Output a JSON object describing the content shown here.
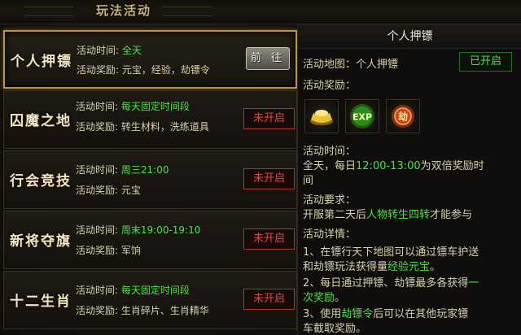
{
  "header": {
    "title": "玩法活动"
  },
  "activities": [
    {
      "name": "个人押镖",
      "time_label": "活动时间:",
      "time": "全天",
      "time_green": true,
      "reward_label": "活动奖励:",
      "reward": "元宝，经验，劫镖令",
      "button": "前 往",
      "status": "open"
    },
    {
      "name": "囚魔之地",
      "time_label": "活动时间:",
      "time": "每天固定时间段",
      "time_green": true,
      "reward_label": "活动奖励:",
      "reward": "转生材料，洗练道具",
      "button": "未开启",
      "status": "closed"
    },
    {
      "name": "行会竞技",
      "time_label": "活动时间:",
      "time": "周三21:00",
      "time_green": true,
      "reward_label": "活动奖励:",
      "reward": "元宝",
      "button": "未开启",
      "status": "closed"
    },
    {
      "name": "新将夺旗",
      "time_label": "活动时间:",
      "time": "周末19:00-19:10",
      "time_green": true,
      "reward_label": "活动奖励:",
      "reward": "军饷",
      "button": "未开启",
      "status": "closed"
    },
    {
      "name": "十二生肖",
      "time_label": "活动时间:",
      "time": "每天固定时间段",
      "time_green": true,
      "reward_label": "活动奖励:",
      "reward": "生肖碎片、生肖精华",
      "button": "未开启",
      "status": "closed"
    }
  ],
  "detail": {
    "title": "个人押镖",
    "map_label": "活动地图：",
    "map": "个人押镖",
    "status": "已开启",
    "reward_label": "活动奖励：",
    "rewards": [
      {
        "icon": "gold-ingot-icon"
      },
      {
        "icon": "exp-icon",
        "text": "EXP"
      },
      {
        "icon": "rob-token-icon",
        "text": "劫"
      }
    ],
    "time_label": "活动时间：",
    "time_prefix": "全天，每日",
    "time_highlight": "12:00-13:00",
    "time_suffix": "为双倍奖励时",
    "time_line2": "间",
    "req_label": "活动要求：",
    "req_prefix": "开服第二天后",
    "req_highlight": "人物转生四转",
    "req_suffix": "才能参与",
    "details_label": "活动详情：",
    "d1_line1": "1、在镖行天下地图可以通过镖车护送",
    "d1_line2_prefix": "和劫镖玩法获得量",
    "d1_line2_highlight": "经验元宝",
    "d1_line2_suffix": "。",
    "d2_line1_prefix": "2、每日通过押镖、劫镖最多各获得",
    "d2_line1_highlight": "一",
    "d2_line2_highlight": "次奖励",
    "d2_line2_suffix": "。",
    "d3_line1_prefix": "3、使用",
    "d3_line1_highlight": "劫镖令",
    "d3_line1_suffix": "后可以在其他玩家镖",
    "d3_line2": "车截取奖励。"
  },
  "colors": {
    "green": "#4ee04a",
    "gold_border": "#b89548",
    "red_button": "#e8453a"
  }
}
